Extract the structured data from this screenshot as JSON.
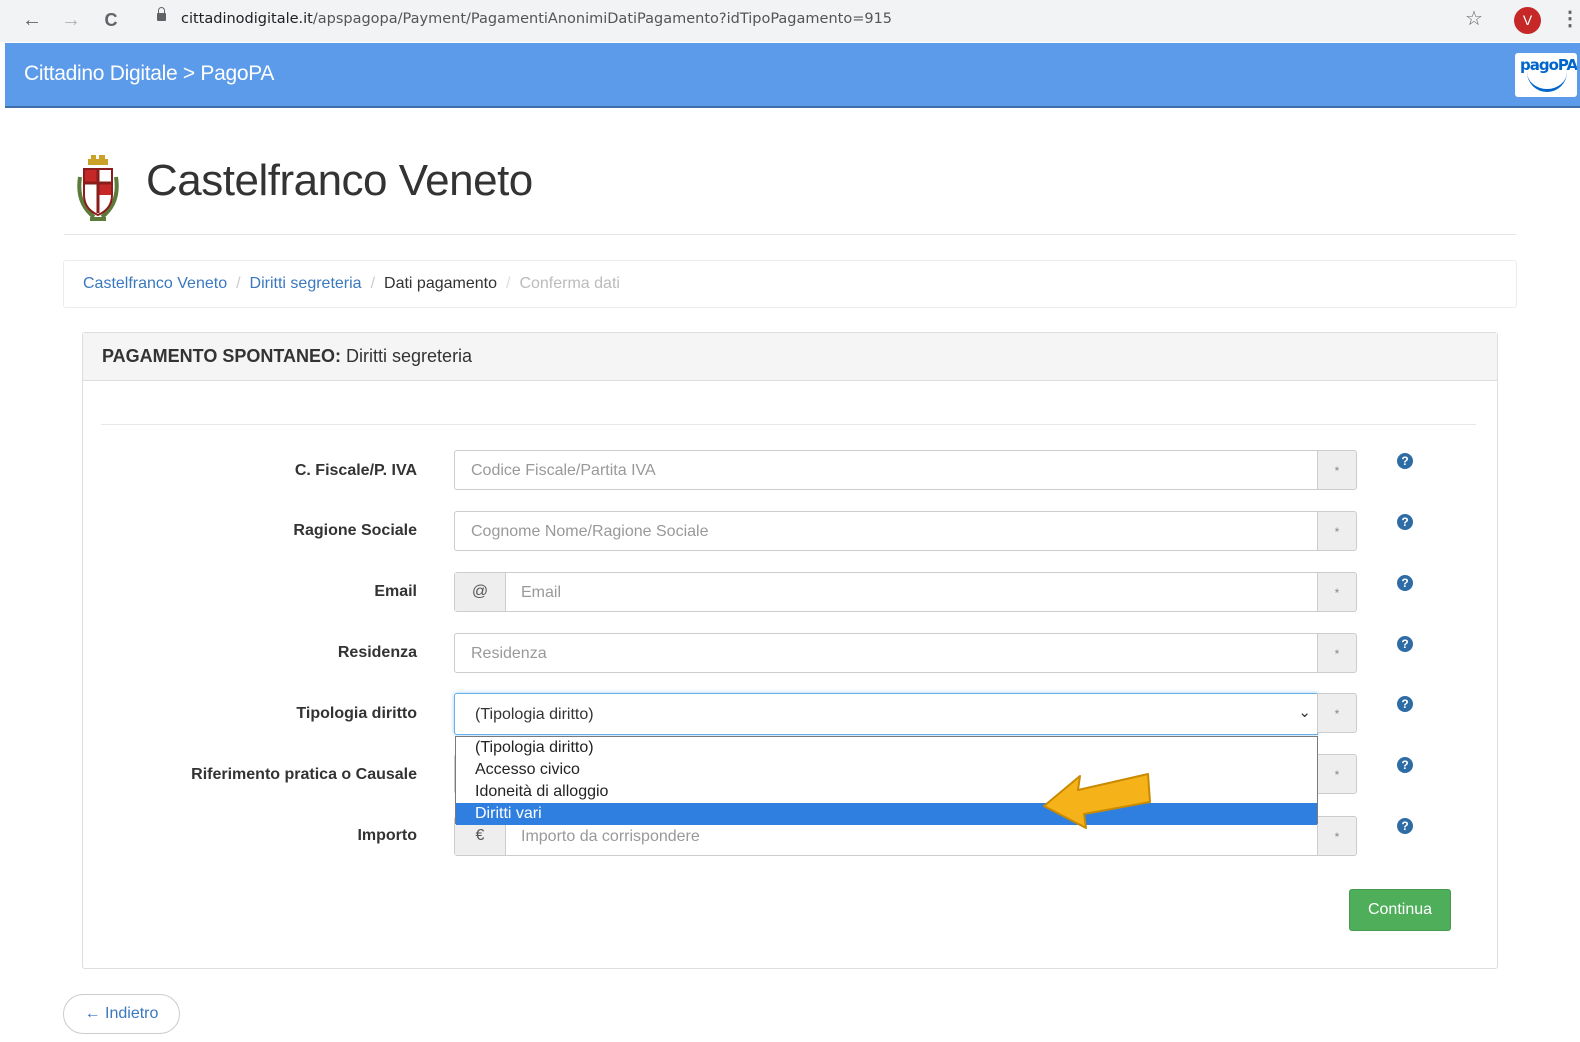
{
  "browser": {
    "url_host": "cittadinodigitale.it",
    "url_path": "/apspagopa/Payment/PagamentiAnonimiDatiPagamento?idTipoPagamento=915",
    "profile_initial": "V",
    "back_icon": "←",
    "forward_icon": "→",
    "reload_icon": "C",
    "star_icon": "☆",
    "menu_icon": "⋮"
  },
  "appbar": {
    "title": "Cittadino Digitale > PagoPA",
    "logo_text": "pagoPA"
  },
  "header": {
    "town_name": "Castelfranco Veneto"
  },
  "breadcrumb": {
    "items": [
      "Castelfranco Veneto",
      "Diritti segreteria",
      "Dati pagamento",
      "Conferma dati"
    ],
    "separator": "/"
  },
  "panel": {
    "title_bold": "PAGAMENTO SPONTANEO:",
    "title_rest": "Diritti segreteria"
  },
  "form": {
    "required_marker": "*",
    "help_glyph": "?",
    "fields": [
      {
        "label": "C. Fiscale/P. IVA",
        "placeholder": "Codice Fiscale/Partita IVA"
      },
      {
        "label": "Ragione Sociale",
        "placeholder": "Cognome Nome/Ragione Sociale"
      },
      {
        "label": "Email",
        "placeholder": "Email",
        "addon": "@"
      },
      {
        "label": "Residenza",
        "placeholder": "Residenza"
      },
      {
        "label": "Tipologia diritto",
        "value": "(Tipologia diritto)"
      },
      {
        "label": "Riferimento pratica o Causale",
        "placeholder": ""
      },
      {
        "label": "Importo",
        "placeholder": "Importo da corrispondere",
        "addon": "€"
      }
    ],
    "dropdown_options": [
      "(Tipologia diritto)",
      "Accesso civico",
      "Idoneità di alloggio",
      "Diritti vari"
    ],
    "highlighted_option": "Diritti vari",
    "continue_label": "Continua",
    "back_label": "← Indietro"
  },
  "colors": {
    "appbar": "#5b9bea",
    "link": "#3a78bf",
    "success": "#4fae5a",
    "highlight": "#2f7fe0",
    "arrow": "#f5b319"
  }
}
